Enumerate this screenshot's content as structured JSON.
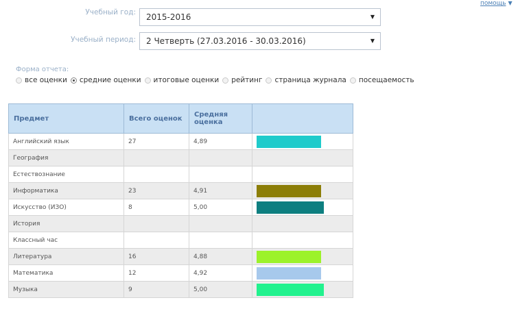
{
  "help": {
    "label": "помощь"
  },
  "filters": {
    "year_label": "Учебный год:",
    "year_value": "2015-2016",
    "period_label": "Учебный период:",
    "period_value": "2 Четверть (27.03.2016 - 30.03.2016)"
  },
  "report": {
    "label": "Форма отчета:",
    "options": [
      {
        "label": "все оценки",
        "checked": false
      },
      {
        "label": "средние оценки",
        "checked": true
      },
      {
        "label": "итоговые оценки",
        "checked": false
      },
      {
        "label": "рейтинг",
        "checked": false
      },
      {
        "label": "страница журнала",
        "checked": false
      },
      {
        "label": "посещаемость",
        "checked": false
      }
    ]
  },
  "table": {
    "headers": {
      "subject": "Предмет",
      "total": "Всего оценок",
      "average": "Средняя оценка"
    },
    "rows": [
      {
        "subject": "Английский язык",
        "total": "27",
        "average": "4,89",
        "bar_fraction": 0.77,
        "bar_color": "#1fcbcb"
      },
      {
        "subject": "География",
        "total": "",
        "average": "",
        "bar_fraction": 0,
        "bar_color": ""
      },
      {
        "subject": "Естествознание",
        "total": "",
        "average": "",
        "bar_fraction": 0,
        "bar_color": ""
      },
      {
        "subject": "Информатика",
        "total": "23",
        "average": "4,91",
        "bar_fraction": 0.77,
        "bar_color": "#8c7e08"
      },
      {
        "subject": "Искусство (ИЗО)",
        "total": "8",
        "average": "5,00",
        "bar_fraction": 0.8,
        "bar_color": "#0e7f80"
      },
      {
        "subject": "История",
        "total": "",
        "average": "",
        "bar_fraction": 0,
        "bar_color": ""
      },
      {
        "subject": "Классный час",
        "total": "",
        "average": "",
        "bar_fraction": 0,
        "bar_color": ""
      },
      {
        "subject": "Литература",
        "total": "16",
        "average": "4,88",
        "bar_fraction": 0.77,
        "bar_color": "#9cf22a"
      },
      {
        "subject": "Математика",
        "total": "12",
        "average": "4,92",
        "bar_fraction": 0.77,
        "bar_color": "#a7c9ec"
      },
      {
        "subject": "Музыка",
        "total": "9",
        "average": "5,00",
        "bar_fraction": 0.8,
        "bar_color": "#22f28e"
      }
    ]
  }
}
